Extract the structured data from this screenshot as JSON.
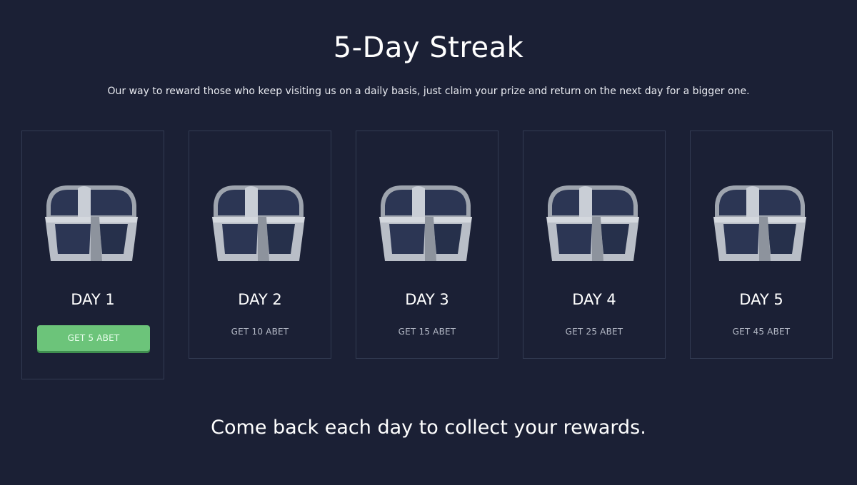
{
  "header": {
    "title": "5-Day Streak",
    "subtitle": "Our way to reward those who keep visiting us on a daily basis, just claim your prize and return on the next day for a bigger one."
  },
  "days": [
    {
      "label": "DAY 1",
      "reward": "GET 5 ABET",
      "state": "claimable"
    },
    {
      "label": "DAY 2",
      "reward": "GET 10 ABET",
      "state": "locked"
    },
    {
      "label": "DAY 3",
      "reward": "GET 15 ABET",
      "state": "locked"
    },
    {
      "label": "DAY 4",
      "reward": "GET 25 ABET",
      "state": "locked"
    },
    {
      "label": "DAY 5",
      "reward": "GET 45 ABET",
      "state": "locked"
    }
  ],
  "footer": {
    "message": "Come back each day to collect your rewards."
  },
  "icons": {
    "reward": "treasure-chest-icon"
  },
  "colors": {
    "background": "#1b2035",
    "card_border": "#323b52",
    "claim_button": "#6cc47a",
    "chest_metal": "#b9bec7",
    "chest_panel": "#2c3654"
  }
}
